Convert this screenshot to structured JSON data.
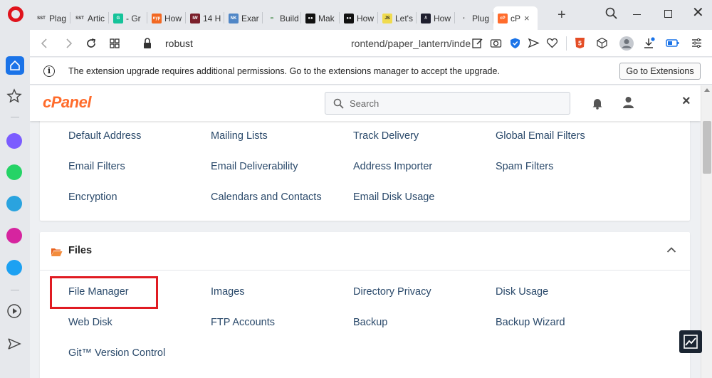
{
  "browser": {
    "tabs": [
      {
        "favicon_text": "SST",
        "favicon_color": "#e6e8ec",
        "favicon_fg": "#333333",
        "label": "Plag"
      },
      {
        "favicon_text": "SST",
        "favicon_color": "#e6e8ec",
        "favicon_fg": "#333333",
        "label": "Artic"
      },
      {
        "favicon_text": "G",
        "favicon_color": "#15c39a",
        "favicon_fg": "#ffffff",
        "label": "- Gr"
      },
      {
        "favicon_text": "nyp",
        "favicon_color": "#f26822",
        "favicon_fg": "#ffffff",
        "label": "How"
      },
      {
        "favicon_text": "IW",
        "favicon_color": "#7a1f2b",
        "favicon_fg": "#ffffff",
        "label": "14 H"
      },
      {
        "favicon_text": "NK",
        "favicon_color": "#4f86c6",
        "favicon_fg": "#ffffff",
        "label": "Exar"
      },
      {
        "favicon_text": "∞",
        "favicon_color": "#e6e8ec",
        "favicon_fg": "#2e7d32",
        "label": "Build"
      },
      {
        "favicon_text": "●●",
        "favicon_color": "#111111",
        "favicon_fg": "#ffffff",
        "label": "Mak"
      },
      {
        "favicon_text": "●●",
        "favicon_color": "#111111",
        "favicon_fg": "#ffffff",
        "label": "How"
      },
      {
        "favicon_text": "JS",
        "favicon_color": "#f0db4f",
        "favicon_fg": "#222222",
        "label": "Let's"
      },
      {
        "favicon_text": "/\\",
        "favicon_color": "#1e1e2e",
        "favicon_fg": "#ffffff",
        "label": "How"
      },
      {
        "favicon_text": "◐",
        "favicon_color": "#e6e8ec",
        "favicon_fg": "#555555",
        "label": "Plug"
      },
      {
        "favicon_text": "cP",
        "favicon_color": "#ff6c2c",
        "favicon_fg": "#ffffff",
        "label": "cP",
        "active": true
      }
    ],
    "new_tab": "+",
    "close_tab": "×",
    "window_close": "✕",
    "url_host": "robust",
    "url_path": "rontend/paper_lantern/inde"
  },
  "notice": {
    "info_glyph": "i",
    "text": "The extension upgrade requires additional permissions. Go to the extensions manager to accept the upgrade.",
    "button": "Go to Extensions"
  },
  "cpanel": {
    "logo": "cPanel",
    "search_placeholder": "Search",
    "close": "×",
    "email_links": [
      [
        "Default Address",
        "Mailing Lists",
        "Track Delivery",
        "Global Email Filters"
      ],
      [
        "Email Filters",
        "Email Deliverability",
        "Address Importer",
        "Spam Filters"
      ],
      [
        "Encryption",
        "Calendars and Contacts",
        "Email Disk Usage"
      ]
    ],
    "files": {
      "title": "Files",
      "links": [
        [
          "File Manager",
          "Images",
          "Directory Privacy",
          "Disk Usage"
        ],
        [
          "Web Disk",
          "FTP Accounts",
          "Backup",
          "Backup Wizard"
        ],
        [
          "Git™ Version Control"
        ]
      ],
      "highlighted": "File Manager"
    }
  },
  "colors": {
    "brand": "#ff6c2c",
    "highlight": "#e01b22",
    "link": "#2b4a6b",
    "opera_red": "#e0131c"
  }
}
